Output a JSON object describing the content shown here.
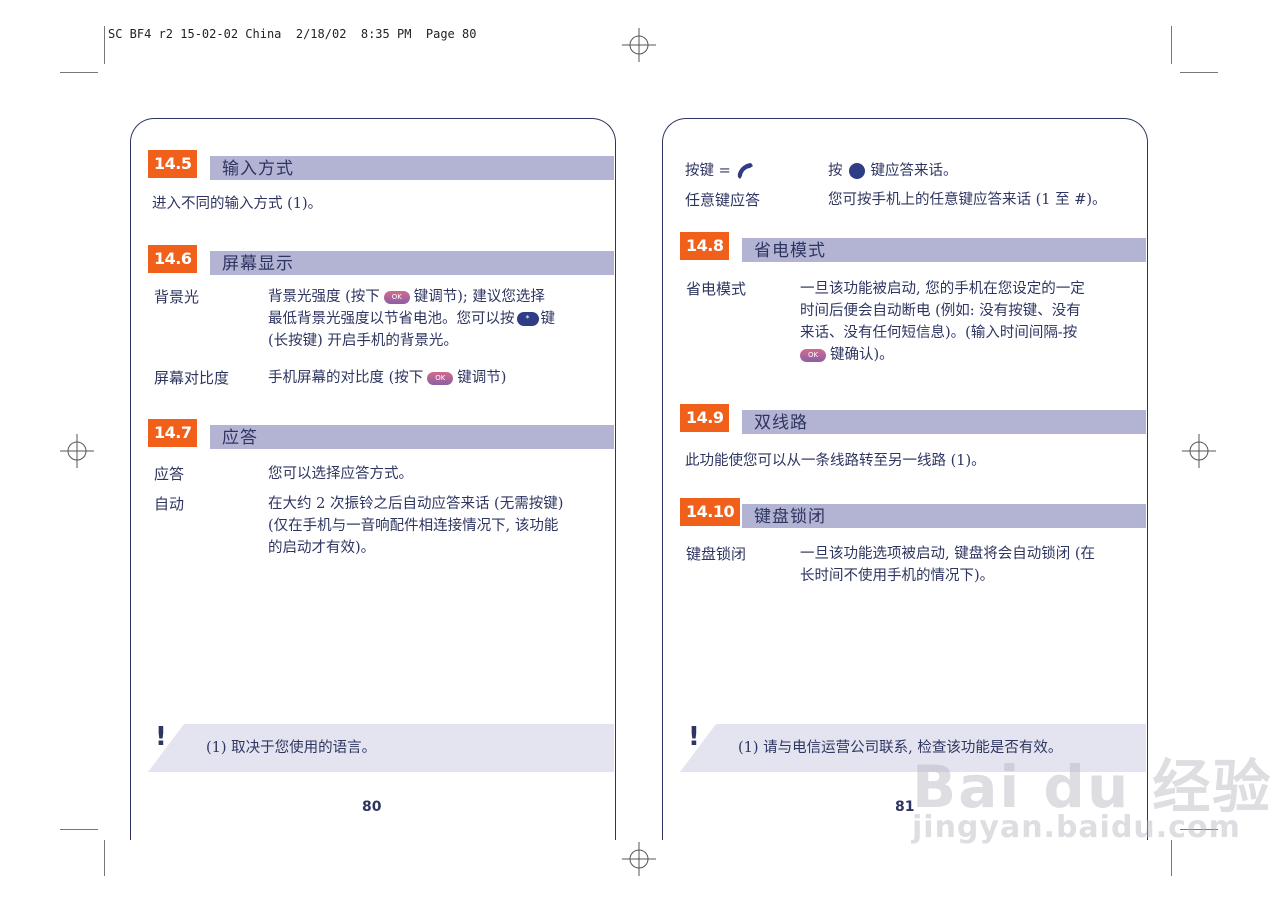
{
  "meta": {
    "text": "SC BF4 r2 15-02-02 China  2/18/02  8:35 PM  Page 80"
  },
  "left": {
    "s145": {
      "num": "14.5",
      "title": "输入方式",
      "body": "进入不同的输入方式 (1)。"
    },
    "s146": {
      "num": "14.6",
      "title": "屏幕显示",
      "backlight_label": "背景光",
      "backlight_l1a": "背景光强度 (按下",
      "backlight_l1b": "键调节);  建议您选择",
      "backlight_l2a": "最低背景光强度以节省电池。您可以按",
      "backlight_l2b": "键",
      "backlight_l3": "(长按键) 开启手机的背景光。",
      "contrast_label": "屏幕对比度",
      "contrast_a": "手机屏幕的对比度 (按下",
      "contrast_b": "键调节)"
    },
    "s147": {
      "num": "14.7",
      "title": "应答",
      "answer_label": "应答",
      "answer_text": "您可以选择应答方式。",
      "auto_label": "自动",
      "auto_l1": "在大约 2 次振铃之后自动应答来话 (无需按键)",
      "auto_l2": "(仅在手机与一音响配件相连接情况下,  该功能",
      "auto_l3": "的启动才有效)。"
    },
    "note": {
      "mark": "!",
      "text": "(1)  取决于您使用的语言。"
    },
    "page_number": "80"
  },
  "right": {
    "top": {
      "key_label": "按键 =",
      "key_a": "按",
      "key_b": "键应答来话。",
      "any_label": "任意键应答",
      "any_text": "您可按手机上的任意键应答来话  (1 至 #)。"
    },
    "s148": {
      "num": "14.8",
      "title": "省电模式",
      "label": "省电模式",
      "l1": "一旦该功能被启动,  您的手机在您设定的一定",
      "l2": "时间后便会自动断电 (例如:  没有按键、没有",
      "l3": "来话、没有任何短信息)。(输入时间间隔-按",
      "l4": "键确认)。"
    },
    "s149": {
      "num": "14.9",
      "title": "双线路",
      "body": "此功能使您可以从一条线路转至另一线路 (1)。"
    },
    "s1410": {
      "num": "14.10",
      "title": "键盘锁闭",
      "label": "键盘锁闭",
      "l1": "一旦该功能选项被启动,  键盘将会自动锁闭 (在",
      "l2": "长时间不使用手机的情况下)。"
    },
    "note": {
      "mark": "!",
      "text": "(1)  请与电信运营公司联系,  检查该功能是否有效。"
    },
    "page_number": "81"
  },
  "keys": {
    "ok": "OK",
    "star": "*",
    "hash": "#"
  },
  "watermark": {
    "brand": "Bai du 经验",
    "url": "jingyan.baidu.com"
  }
}
